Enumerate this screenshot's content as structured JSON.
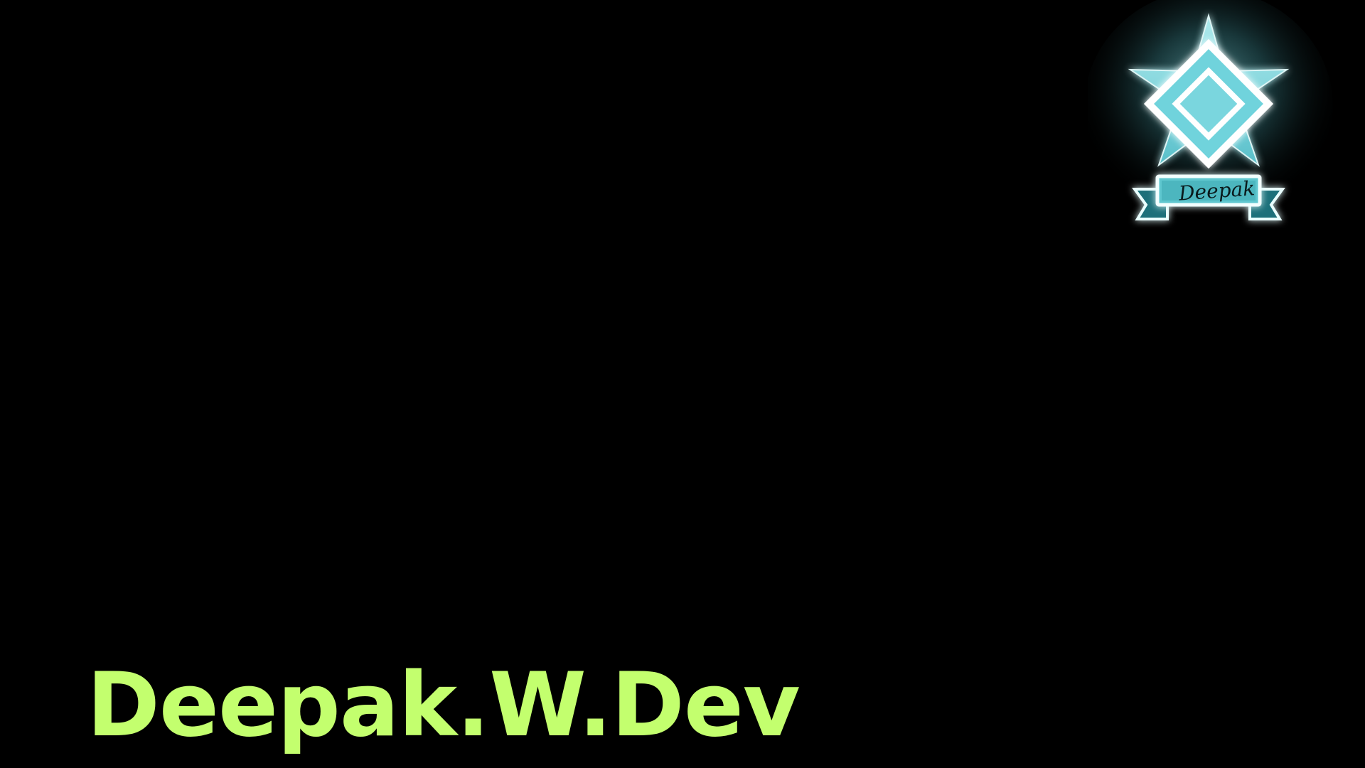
{
  "brand": {
    "title": "Deepak.W.Dev",
    "title_color": "#c3ff6e"
  },
  "badge": {
    "ribbon_text": "Deepak",
    "glow_color": "#7fe6ee",
    "icon": "star-diamond-emblem-icon"
  }
}
